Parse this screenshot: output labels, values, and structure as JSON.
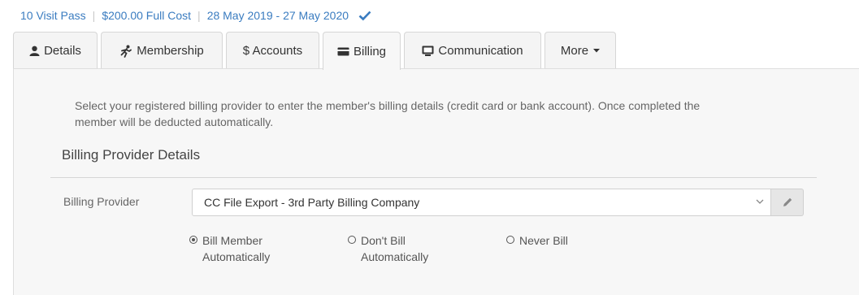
{
  "summary": {
    "pass": "10 Visit Pass",
    "cost": "$200.00 Full Cost",
    "dates": "28 May 2019 - 27 May 2020",
    "separator": "|",
    "verified_icon": "check-icon"
  },
  "tabs": [
    {
      "label": "Details",
      "icon": "user-icon",
      "active": false
    },
    {
      "label": "Membership",
      "icon": "running-person-icon",
      "active": false
    },
    {
      "label": "$ Accounts",
      "active": false
    },
    {
      "label": "Billing",
      "icon": "credit-card-icon",
      "active": true
    },
    {
      "label": "Communication",
      "icon": "monitor-icon",
      "active": false
    },
    {
      "label": "More",
      "icon": "caret-down-icon",
      "active": false
    }
  ],
  "billing": {
    "intro_line1": "Select your registered billing provider to enter the member's billing details (credit card or bank account). Once completed the",
    "intro_line2": "member will be deducted automatically.",
    "section_title": "Billing Provider Details",
    "provider_label": "Billing Provider",
    "provider_value": "CC File Export - 3rd Party Billing Company",
    "radios": [
      {
        "line1": "Bill Member",
        "line2": "Automatically",
        "checked": true
      },
      {
        "line1": "Don't Bill",
        "line2": "Automatically",
        "checked": false
      },
      {
        "line1": "Never Bill",
        "line2": "",
        "checked": false
      }
    ]
  },
  "colors": {
    "link": "#3a7cc0",
    "panel_bg": "#f7f7f7",
    "tab_bg": "#f4f4f4"
  }
}
